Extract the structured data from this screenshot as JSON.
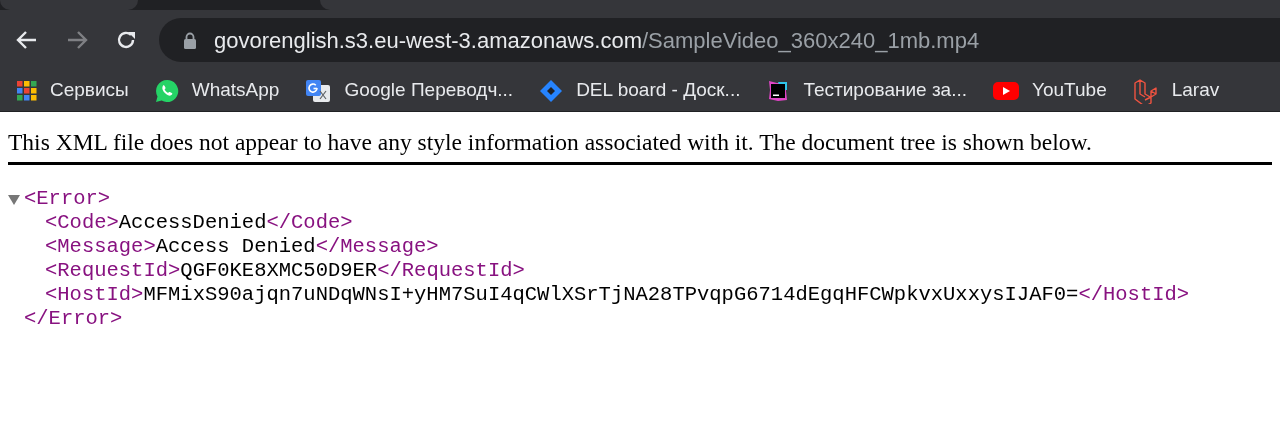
{
  "toolbar": {
    "back": {
      "disabled": false
    },
    "forward": {
      "disabled": true
    },
    "address": {
      "host": "govorenglish.s3.eu-west-3.amazonaws.com",
      "path": "/SampleVideo_360x240_1mb.mp4"
    }
  },
  "bookmarks": [
    {
      "kind": "apps",
      "label": "Сервисы"
    },
    {
      "kind": "whatsapp",
      "label": "WhatsApp"
    },
    {
      "kind": "translate",
      "label": "Google Переводч..."
    },
    {
      "kind": "jira",
      "label": "DEL board - Доск..."
    },
    {
      "kind": "youtrack",
      "label": "Тестирование за..."
    },
    {
      "kind": "youtube",
      "label": "YouTube"
    },
    {
      "kind": "laravel",
      "label": "Larav"
    }
  ],
  "notice": "This XML file does not appear to have any style information associated with it. The document tree is shown below.",
  "xml": {
    "open": "<Error>",
    "close": "</Error>",
    "expanded": true,
    "children": [
      {
        "open": "<Code>",
        "value": "AccessDenied",
        "close": "</Code>"
      },
      {
        "open": "<Message>",
        "value": "Access Denied",
        "close": "</Message>"
      },
      {
        "open": "<RequestId>",
        "value": "QGF0KE8XMC50D9ER",
        "close": "</RequestId>"
      },
      {
        "open": "<HostId>",
        "value": "MFMixS90ajqn7uNDqWNsI+yHM7SuI4qCWlXSrTjNA28TPvqpG6714dEgqHFCWpkvxUxxysIJAF0=",
        "close": "</HostId>"
      }
    ]
  }
}
